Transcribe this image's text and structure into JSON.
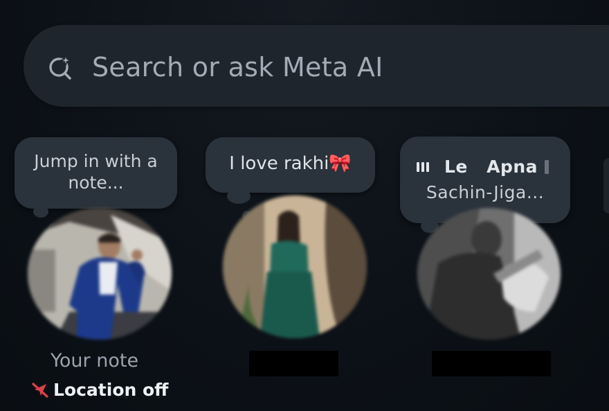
{
  "search": {
    "placeholder": "Search or ask Meta AI"
  },
  "notes": [
    {
      "bubble_text": "Jump in with a note...",
      "label": "Your note",
      "location_status": "Location off"
    },
    {
      "bubble_text": "I love rakhi🎀"
    },
    {
      "song_title": "Le   Apna",
      "artist": "Sachin-Jiga..."
    }
  ],
  "colors": {
    "background": "#0c1117",
    "bubble": "#2a323b",
    "search_bar": "#1f252d",
    "location_off_icon": "#e0404a"
  },
  "icons": {
    "search": "search-sparkle-icon",
    "music": "music-bars-icon",
    "location": "location-off-icon"
  }
}
